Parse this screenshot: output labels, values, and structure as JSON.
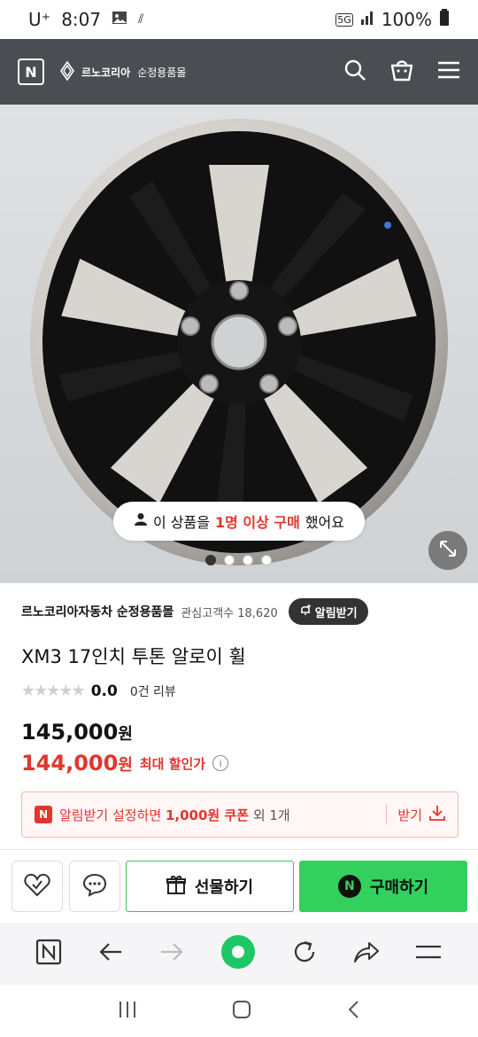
{
  "status_bar": {
    "carrier": "U⁺",
    "time": "8:07",
    "network": "5G",
    "battery": "100%"
  },
  "header": {
    "logo_label": "N",
    "brand_name": "르노코리아",
    "brand_subtitle": "순정용품몰",
    "icons": [
      "search-icon",
      "cart-icon",
      "menu-icon"
    ]
  },
  "hero": {
    "purchase_prefix": "이 상품을",
    "purchase_highlight": "1명 이상 구매",
    "purchase_suffix": "했어요",
    "page_count": 4,
    "active_page": 1
  },
  "product": {
    "seller": "르노코리아자동차 순정용품몰",
    "watchers_label": "관심고객수 18,620",
    "alert_button": "알림받기",
    "title": "XM3 17인치 투톤 알로이 휠",
    "rating": "0.0",
    "reviews": "0건 리뷰",
    "price": "145,000",
    "price_unit": "원",
    "sale_price": "144,000",
    "sale_unit": "원",
    "sale_label": "최대 할인가"
  },
  "coupon": {
    "badge": "N",
    "text_prefix": "알림받기 설정하면",
    "amount": "1,000원 쿠폰",
    "text_suffix": "외 1개",
    "get_label": "받기"
  },
  "actions": {
    "gift_label": "선물하기",
    "buy_label": "구매하기",
    "buy_badge": "N"
  },
  "colors": {
    "header_bg": "#4a4e52",
    "accent_red": "#e0362e",
    "naver_green": "#33d05d"
  }
}
